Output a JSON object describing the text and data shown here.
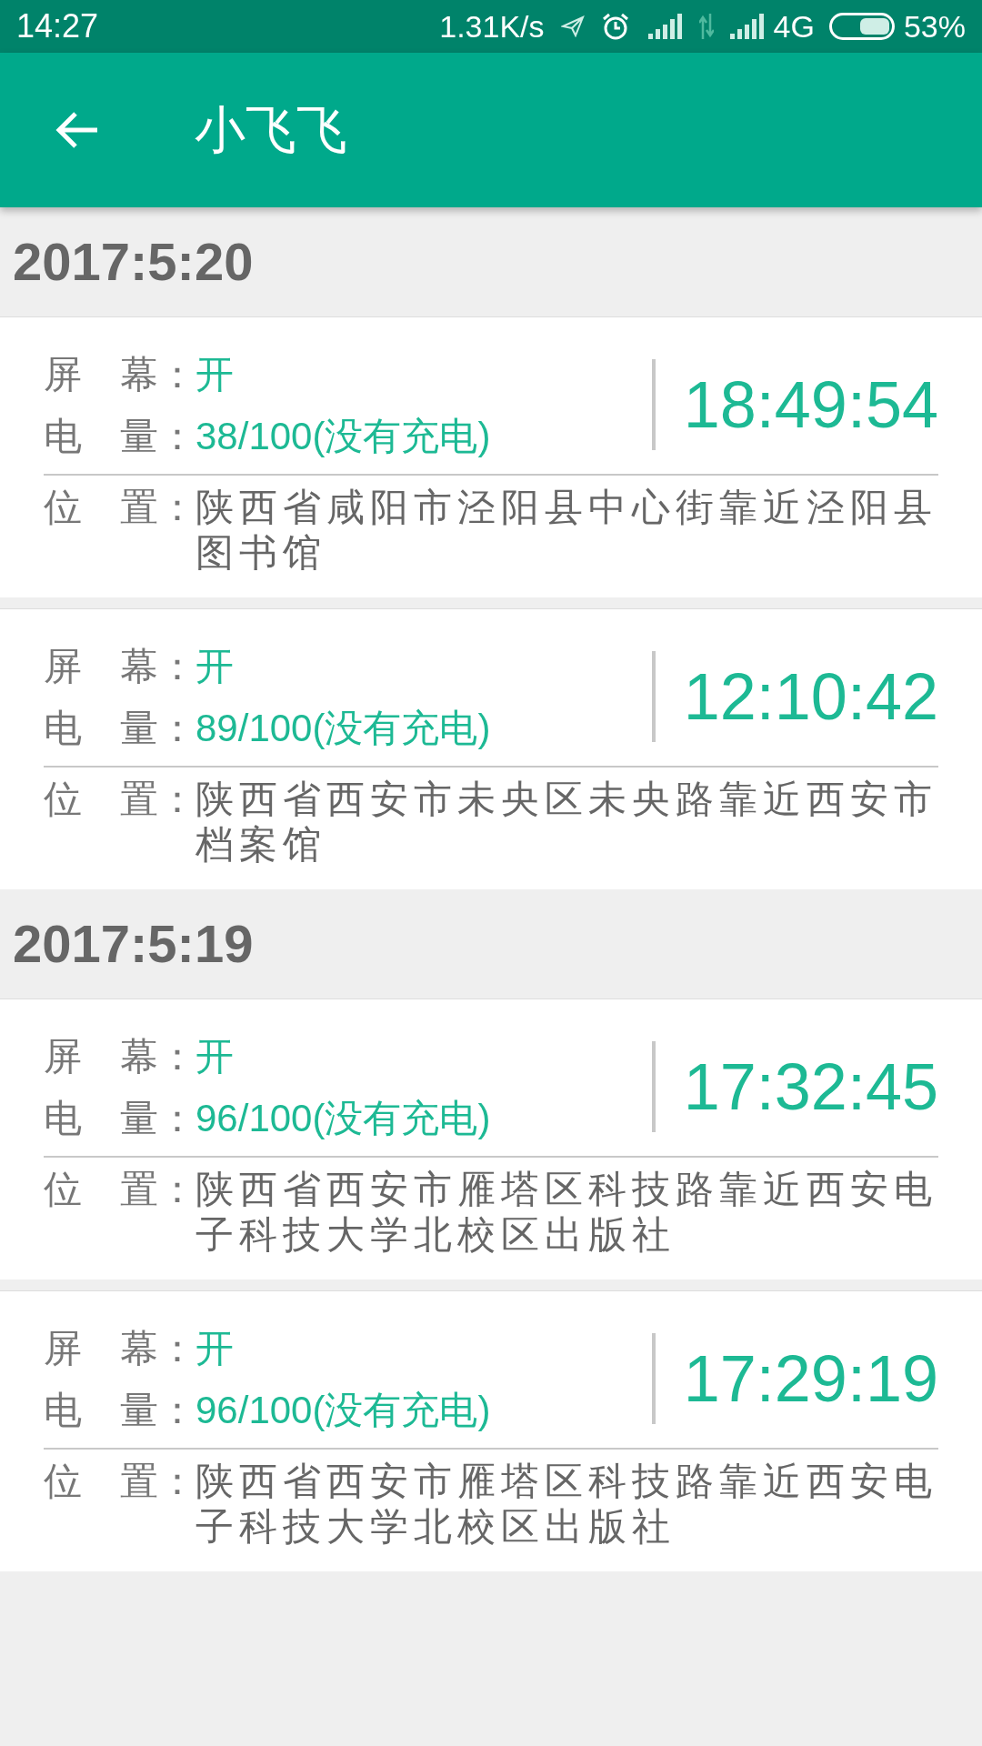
{
  "status_bar": {
    "time": "14:27",
    "speed": "1.31K/s",
    "network": "4G",
    "battery": "53%"
  },
  "app_bar": {
    "title": "小飞飞"
  },
  "groups": [
    {
      "date": "2017:5:20",
      "records": [
        {
          "screen_label": "屏　幕：",
          "screen": "开",
          "battery_label": "电　量：",
          "battery": "38/100(没有充电)",
          "time": "18:49:54",
          "location_label": "位　置：",
          "location": "陕西省咸阳市泾阳县中心街靠近泾阳县图书馆"
        },
        {
          "screen_label": "屏　幕：",
          "screen": "开",
          "battery_label": "电　量：",
          "battery": "89/100(没有充电)",
          "time": "12:10:42",
          "location_label": "位　置：",
          "location": "陕西省西安市未央区未央路靠近西安市档案馆"
        }
      ]
    },
    {
      "date": "2017:5:19",
      "records": [
        {
          "screen_label": "屏　幕：",
          "screen": "开",
          "battery_label": "电　量：",
          "battery": "96/100(没有充电)",
          "time": "17:32:45",
          "location_label": "位　置：",
          "location": "陕西省西安市雁塔区科技路靠近西安电子科技大学北校区出版社"
        },
        {
          "screen_label": "屏　幕：",
          "screen": "开",
          "battery_label": "电　量：",
          "battery": "96/100(没有充电)",
          "time": "17:29:19",
          "location_label": "位　置：",
          "location": "陕西省西安市雁塔区科技路靠近西安电子科技大学北校区出版社"
        }
      ]
    }
  ]
}
